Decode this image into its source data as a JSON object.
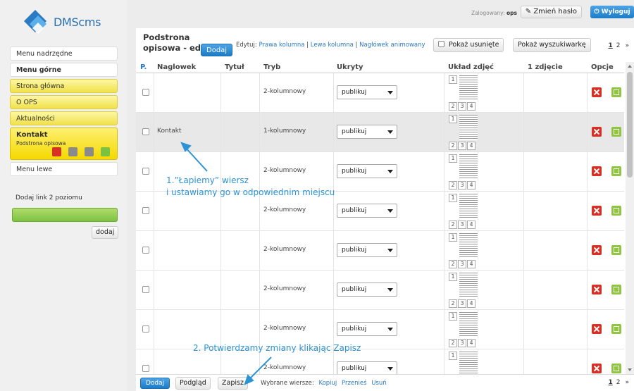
{
  "app": {
    "logo_text": "DMScms",
    "brand_color": "#2a7ac4"
  },
  "sidebar": {
    "items": [
      {
        "label": "Menu nadrzędne"
      },
      {
        "label": "Menu górne"
      },
      {
        "label": "Strona główna"
      },
      {
        "label": "O OPS"
      },
      {
        "label": "Aktualności"
      },
      {
        "label": "Kontakt",
        "sub": "Podstrona opisowa"
      },
      {
        "label": "Menu lewe"
      }
    ],
    "add_link_label": "Dodaj link 2 poziomu",
    "add_button": "dodaj"
  },
  "topbar": {
    "logged_prefix": "Zalogowany:",
    "logged_user": "ops",
    "change_password": "Zmień hasło",
    "logout": "Wyloguj"
  },
  "main": {
    "title": "Podstrona opisowa - edycja",
    "add_button": "Dodaj",
    "edit_prefix": "Edytuj:",
    "edit_links": [
      "Prawa kolumna",
      "Lewa kolumna",
      "Nagłówek animowany"
    ],
    "show_deleted": "Pokaż usunięte",
    "show_search": "Pokaż wyszukiwarkę",
    "pages": [
      "1",
      "2",
      "»"
    ]
  },
  "table": {
    "columns": [
      "P.",
      "Naglowek",
      "Tytuł",
      "Tryb",
      "Ukryty",
      "Układ zdjęć",
      "1 zdjęcie",
      "Opcje"
    ],
    "layout_labels": [
      "1",
      "2",
      "3",
      "4"
    ],
    "rows": [
      {
        "naglowek": "",
        "tytul": "",
        "tryb": "2-kolumnowy",
        "ukryty": "publikuj",
        "highlighted": false
      },
      {
        "naglowek": "Kontakt",
        "tytul": "",
        "tryb": "1-kolumnowy",
        "ukryty": "publikuj",
        "highlighted": true
      },
      {
        "naglowek": "",
        "tytul": "",
        "tryb": "2-kolumnowy",
        "ukryty": "publikuj",
        "highlighted": false
      },
      {
        "naglowek": "",
        "tytul": "",
        "tryb": "2-kolumnowy",
        "ukryty": "publikuj",
        "highlighted": false
      },
      {
        "naglowek": "",
        "tytul": "",
        "tryb": "2-kolumnowy",
        "ukryty": "publikuj",
        "highlighted": false
      },
      {
        "naglowek": "",
        "tytul": "",
        "tryb": "2-kolumnowy",
        "ukryty": "publikuj",
        "highlighted": false
      },
      {
        "naglowek": "",
        "tytul": "",
        "tryb": "2-kolumnowy",
        "ukryty": "publikuj",
        "highlighted": false
      },
      {
        "naglowek": "",
        "tytul": "",
        "tryb": "2-kolumnowy",
        "ukryty": "publikuj",
        "highlighted": false
      }
    ]
  },
  "footer": {
    "add_button": "Dodaj",
    "preview_button": "Podgląd",
    "save_button": "Zapisz",
    "selected_label": "Wybrane wiersze:",
    "actions": [
      "Kopiuj",
      "Przenieś",
      "Usuń"
    ],
    "pages": [
      "1",
      "2",
      "»"
    ]
  },
  "annotations": {
    "step1_line1": "1.”Łapiemy” wiersz",
    "step1_line2": "i ustawiamy go w odpowiednim miejscu",
    "step2": "2. Potwierdzamy zmiany klikając Zapisz",
    "color": "#2c93d4"
  }
}
